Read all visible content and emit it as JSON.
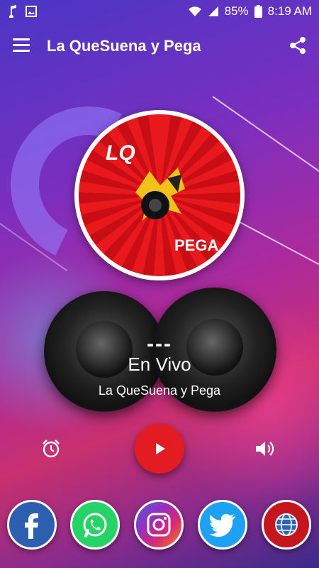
{
  "status_bar": {
    "left_icons": [
      "music-note-icon",
      "image-icon"
    ],
    "battery": "85%",
    "time": "8:19 AM",
    "right_icons": [
      "wifi-icon",
      "signal-icon",
      "battery-icon"
    ]
  },
  "app_bar": {
    "title": "La QueSuena y Pega",
    "menu_icon": "hamburger-menu-icon",
    "share_icon": "share-icon"
  },
  "logo": {
    "top_text": "LQ",
    "bottom_text": "PEGA"
  },
  "player": {
    "track": "---",
    "status": "En Vivo",
    "station": "La QueSuena y Pega",
    "play_icon": "play-icon",
    "alarm_icon": "alarm-clock-icon",
    "volume_icon": "volume-icon"
  },
  "social": [
    {
      "name": "facebook",
      "icon": "facebook-icon",
      "color": "#2d5fb0"
    },
    {
      "name": "whatsapp",
      "icon": "whatsapp-icon",
      "color": "#25d366"
    },
    {
      "name": "instagram",
      "icon": "instagram-icon",
      "color": "#c13584"
    },
    {
      "name": "twitter",
      "icon": "twitter-icon",
      "color": "#1da1f2"
    },
    {
      "name": "website",
      "icon": "globe-icon",
      "color": "#c4161c"
    }
  ],
  "colors": {
    "accent": "#e21c22",
    "background_top": "#4a36c4",
    "background_mid": "#b02a9a"
  }
}
